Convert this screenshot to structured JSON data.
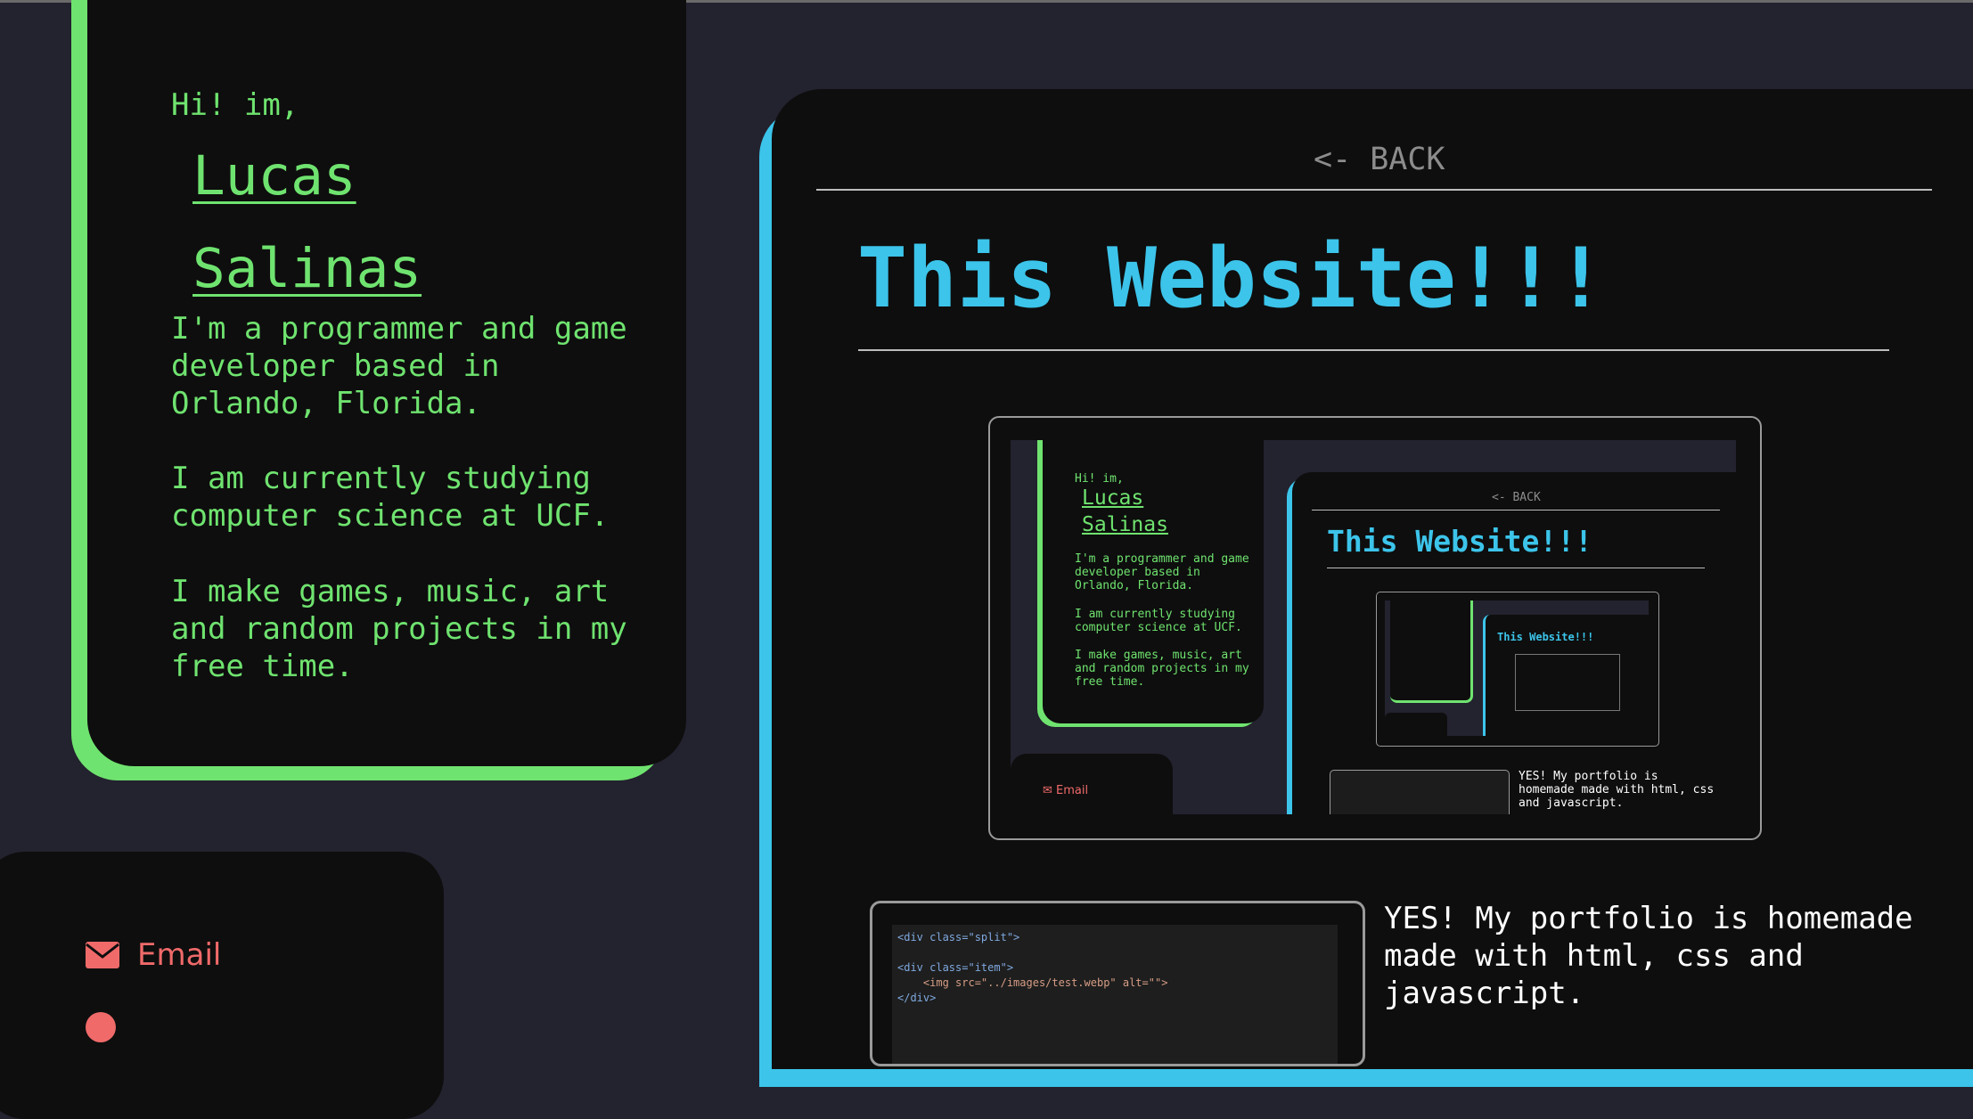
{
  "colors": {
    "background": "#23222f",
    "card": "#0e0e0e",
    "green": "#6fe36f",
    "cyan": "#3cc4ea",
    "red": "#f06a6a"
  },
  "intro": {
    "greeting": "Hi! im,",
    "name_first": "Lucas",
    "name_last": "Salinas",
    "bio": [
      "I'm a programmer and game developer based in Orlando, Florida.",
      "I am currently studying computer science at UCF.",
      "I make games, music, art and random projects in my free time."
    ]
  },
  "contact": {
    "email_label": "Email",
    "email_icon": "envelope-icon"
  },
  "project": {
    "back_label": "<- BACK",
    "title": "This Website!!!",
    "description": "YES! My portfolio is homemade made with html, css and javascript.",
    "code_lines": [
      "<div class=\"split\">",
      "",
      "<div class=\"item\">",
      "    <img src=\"../images/test.webp\" alt=\"\">",
      "</div>"
    ]
  }
}
